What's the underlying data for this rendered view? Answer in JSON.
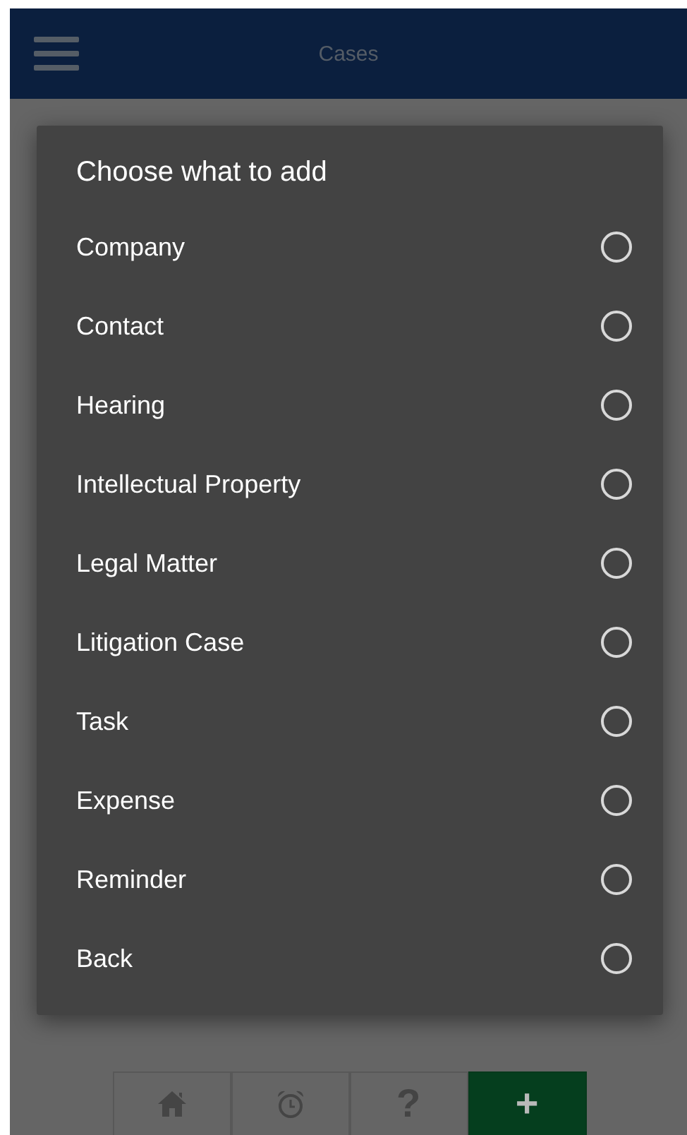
{
  "header": {
    "title": "Cases"
  },
  "dialog": {
    "title": "Choose what to add",
    "options": [
      {
        "label": "Company",
        "selected": false
      },
      {
        "label": "Contact",
        "selected": false
      },
      {
        "label": "Hearing",
        "selected": false
      },
      {
        "label": "Intellectual Property",
        "selected": false
      },
      {
        "label": "Legal Matter",
        "selected": false
      },
      {
        "label": "Litigation Case",
        "selected": false
      },
      {
        "label": "Task",
        "selected": false
      },
      {
        "label": "Expense",
        "selected": false
      },
      {
        "label": "Reminder",
        "selected": false
      },
      {
        "label": "Back",
        "selected": false
      }
    ]
  },
  "toolbar": [
    {
      "kind": "home",
      "selected": false
    },
    {
      "kind": "alarm",
      "selected": false
    },
    {
      "kind": "help",
      "text": "?",
      "selected": false
    },
    {
      "kind": "add",
      "text": "+",
      "selected": true
    }
  ]
}
